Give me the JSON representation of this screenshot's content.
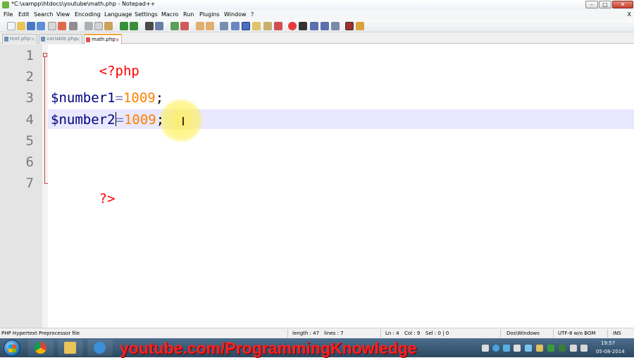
{
  "window": {
    "title": "*C:\\xampp\\htdocs\\youtube\\math.php - Notepad++",
    "min": "–",
    "max": "□",
    "close": "✕"
  },
  "menu": [
    "File",
    "Edit",
    "Search",
    "View",
    "Encoding",
    "Language",
    "Settings",
    "Macro",
    "Run",
    "Plugins",
    "Window",
    "?"
  ],
  "menu_close": "X",
  "tabs": [
    {
      "label": "text.php",
      "active": false
    },
    {
      "label": "variable.php",
      "active": false
    },
    {
      "label": "math.php",
      "active": true
    }
  ],
  "tab_close_glyph": "⨯",
  "editor": {
    "line_numbers": [
      "1",
      "2",
      "3",
      "4",
      "5",
      "6",
      "7"
    ],
    "lines": {
      "l1_tag": "<?php",
      "l3_var": "$number1",
      "l3_op": "=",
      "l3_num": "1009",
      "l3_semi": ";",
      "l4_var": "$number2",
      "l4_op": "=",
      "l4_num": "1009",
      "l4_semi": ";",
      "l7_tag": "?>"
    }
  },
  "status": {
    "file_type": "PHP Hypertext Preprocessor file",
    "length": "length : 47",
    "lines": "lines : 7",
    "ln": "Ln : 4",
    "col": "Col : 9",
    "sel": "Sel : 0 | 0",
    "eol": "Dos\\Windows",
    "encoding": "UTF-8 w/o BOM",
    "mode": "INS"
  },
  "taskbar": {
    "watermark": "youtube.com/ProgrammingKnowledge",
    "time": "19:57",
    "date": "05-08-2014"
  },
  "colors": {
    "php_tag": "#ff0000",
    "variable": "#000080",
    "operator": "#8080c0",
    "number": "#ff8000",
    "current_line": "#e8e8ff",
    "gutter": "#e4e4e4",
    "watermark": "#ff2020"
  }
}
